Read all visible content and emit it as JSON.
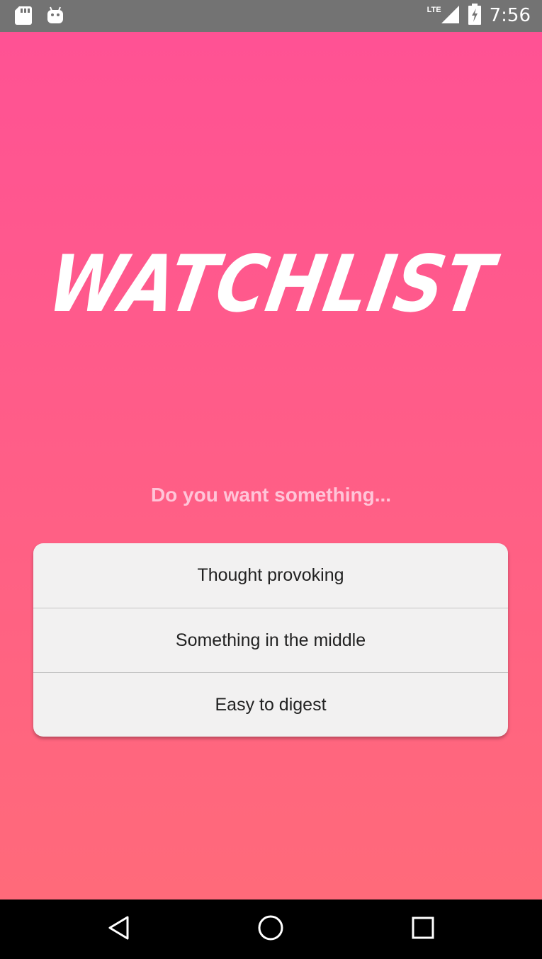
{
  "status_bar": {
    "time": "7:56",
    "network_label": "LTE",
    "icons": [
      "sd-card-icon",
      "android-icon",
      "signal-icon",
      "battery-charging-icon"
    ]
  },
  "app": {
    "logo_text": "WATCHLIST",
    "prompt": "Do you want something...",
    "options": [
      {
        "label": "Thought provoking"
      },
      {
        "label": "Something in the middle"
      },
      {
        "label": "Easy to digest"
      }
    ]
  },
  "nav_bar": {
    "icons": [
      "back-icon",
      "home-icon",
      "recents-icon"
    ]
  },
  "colors": {
    "gradient_top": "#ff5294",
    "gradient_bottom": "#ff6a7a",
    "status_bar": "#737373",
    "card_background": "#f2f1f1",
    "prompt_text": "#ffc5d8"
  }
}
